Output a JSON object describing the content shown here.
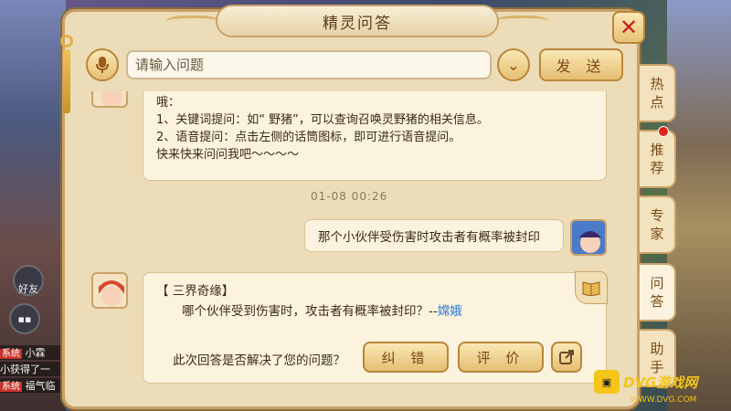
{
  "title": "精灵问答",
  "input": {
    "placeholder": "请输入问题"
  },
  "send_label": "发 送",
  "intro_lines": [
    "哦：",
    "1、关键词提问：如“ 野猪”，可以查询召唤灵野猪的相关信息。",
    "2、语音提问：点击左侧的话筒图标，即可进行语音提问。",
    "快来快来问问我吧～～～～"
  ],
  "timestamp": "01-08 00:26",
  "user_message": "那个小伙伴受伤害时攻击者有概率被封印",
  "answer": {
    "title": "【 三界奇缘】",
    "question_text": "哪个伙伴受到伤害时，攻击者有概率被封印？--",
    "author": "嫦娥",
    "ask_label": "此次回答是否解决了您的问题？",
    "correct_label": "纠 错",
    "rate_label": "评 价"
  },
  "tabs": [
    {
      "label": "热点"
    },
    {
      "label": "推荐"
    },
    {
      "label": "专家"
    },
    {
      "label": "问答"
    },
    {
      "label": "助手"
    }
  ],
  "side": {
    "friends_label": "好友",
    "chat1_tag": "系统",
    "chat1_text": "小霖",
    "chat2_text": "小获得了一",
    "chat3_tag": "系统",
    "chat3_text": "福气临"
  },
  "watermark": {
    "text": "DVG游戏网",
    "url": "WWW.DVG.COM"
  },
  "colors": {
    "panel": "#ecdcb8",
    "border": "#c9a26a",
    "author_link": "#2a7ad8",
    "close": "#c62020"
  }
}
